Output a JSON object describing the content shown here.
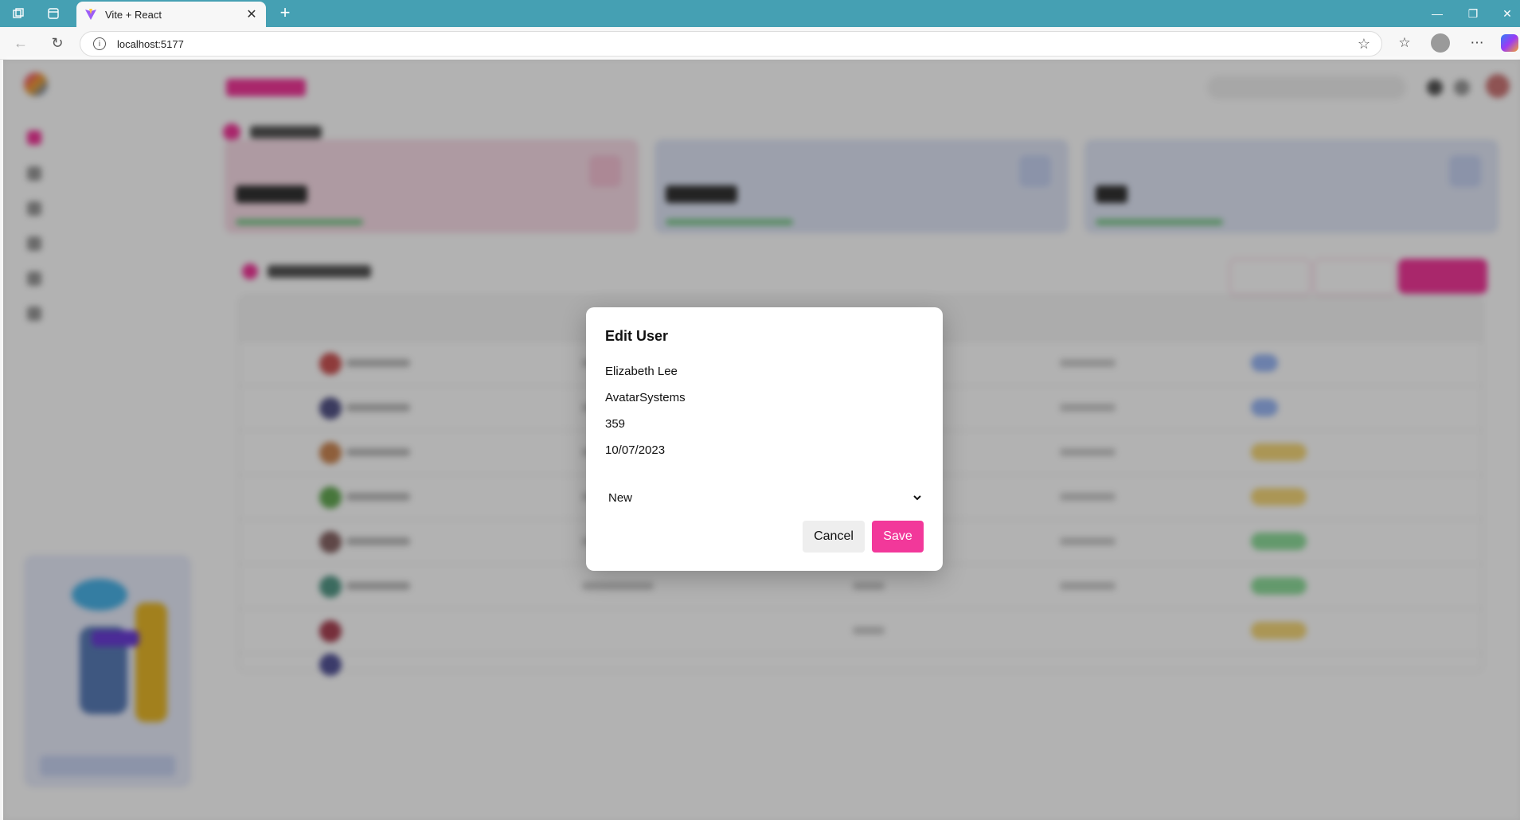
{
  "browser": {
    "tab_title": "Vite + React",
    "url": "localhost:5177",
    "accent": "#45a0b3"
  },
  "modal": {
    "title": "Edit User",
    "name_value": "Elizabeth Lee",
    "company_value": "AvatarSystems",
    "order_value": "359",
    "date_value": "10/07/2023",
    "status_value": "New",
    "cancel_label": "Cancel",
    "save_label": "Save",
    "accent": "#f2389a"
  },
  "icons": [
    "workspaces-icon",
    "tab-actions-icon",
    "vite-favicon-icon",
    "close-tab-icon",
    "new-tab-icon",
    "minimize-icon",
    "maximize-icon",
    "close-window-icon",
    "back-icon",
    "refresh-icon",
    "site-info-icon",
    "favorite-star-icon",
    "favorites-icon",
    "profile-icon",
    "more-icon",
    "copilot-icon",
    "chevron-down-icon"
  ]
}
